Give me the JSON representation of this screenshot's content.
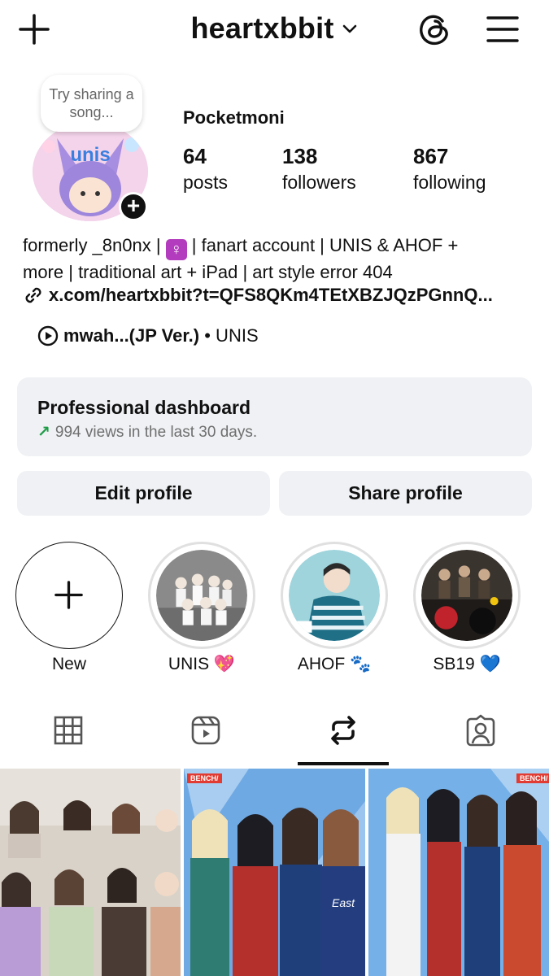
{
  "header": {
    "username": "heartxbbit"
  },
  "profile": {
    "note": "Try sharing a song...",
    "display_name": "Pocketmoni",
    "stats": [
      {
        "value": "64",
        "label": "posts"
      },
      {
        "value": "138",
        "label": "followers"
      },
      {
        "value": "867",
        "label": "following"
      }
    ],
    "bio_line1_a": "formerly _8n0nx | ",
    "bio_line1_b": " | fanart account | UNIS & AHOF +",
    "bio_line2": "more | traditional art + iPad | art style error 404",
    "venus_symbol": "♀",
    "link": "x.com/heartxbbit?t=QFS8QKm4TEtXBZJQzPGnnQ...",
    "music_song": "mwah...(JP Ver.)",
    "music_artist": " • UNIS"
  },
  "dashboard": {
    "title": "Professional dashboard",
    "arrow": "↗",
    "subtitle": "994 views in the last 30 days."
  },
  "buttons": {
    "edit": "Edit profile",
    "share": "Share profile"
  },
  "highlights": [
    {
      "label": "New"
    },
    {
      "label": "UNIS 💖"
    },
    {
      "label": "AHOF 🐾"
    },
    {
      "label": "SB19 💙"
    }
  ],
  "colors": {
    "accent_green": "#1f9c48",
    "button_bg": "#eff1f4",
    "venus_bg": "#b33bbd"
  }
}
